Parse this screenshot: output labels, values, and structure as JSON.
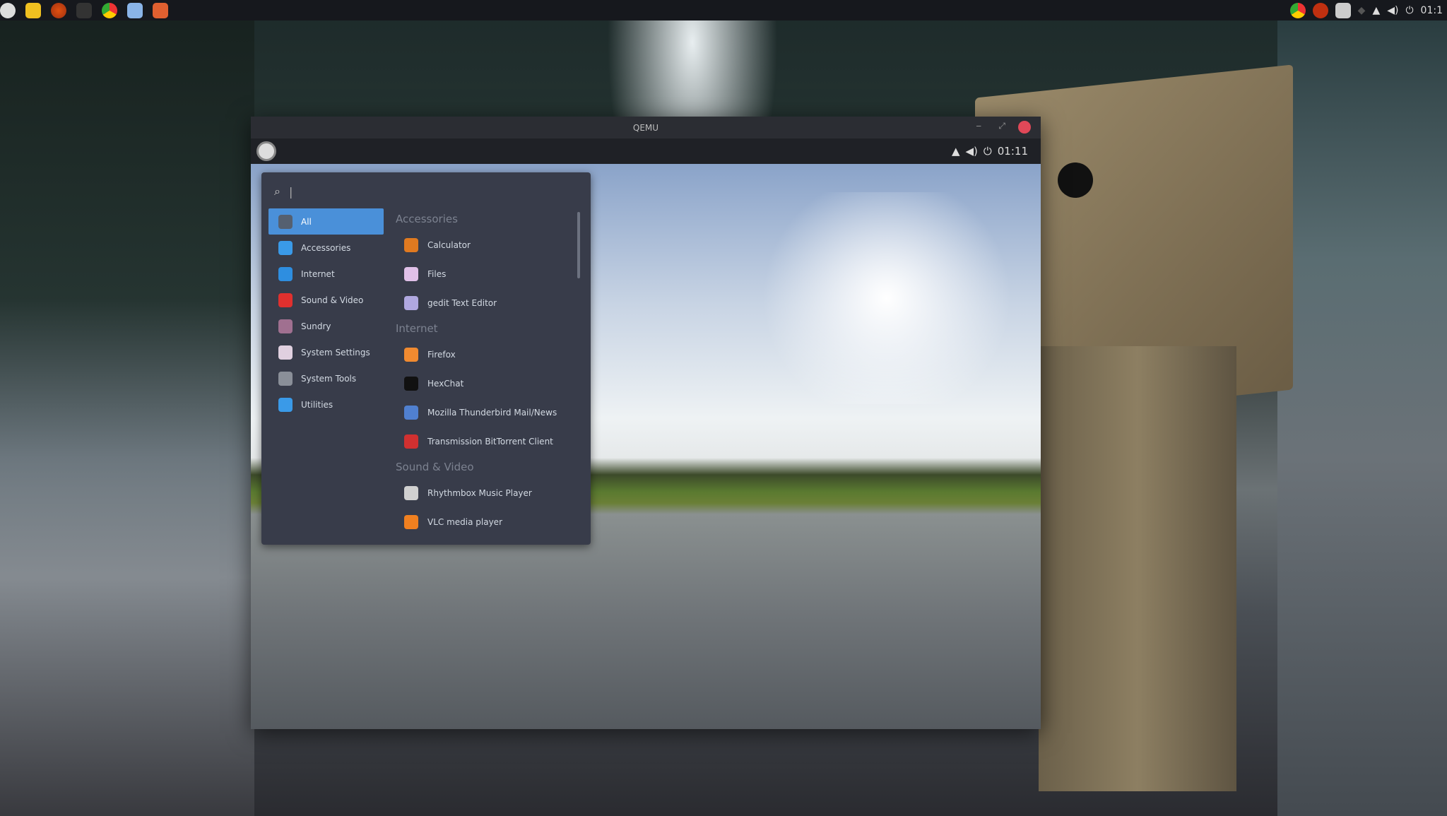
{
  "top_panel": {
    "launchers": [
      "files-icon",
      "cinnamon-icon",
      "terminal-icon",
      "chrome-icon",
      "browser-window-icon",
      "game-icon"
    ],
    "tray": {
      "icons": [
        "chrome-icon",
        "cinnamon-icon",
        "clipboard-icon",
        "network-icon",
        "bell-icon",
        "volume-icon",
        "power-icon"
      ],
      "clock": "01:1"
    }
  },
  "window": {
    "title": "QEMU",
    "minimize": "‒",
    "maximize": "⤢",
    "panel": {
      "clock": "01:11"
    },
    "menu": {
      "search_placeholder": "",
      "categories": [
        {
          "label": "All",
          "color": "#556070",
          "selected": true
        },
        {
          "label": "Accessories",
          "color": "#3a9ae8"
        },
        {
          "label": "Internet",
          "color": "#2e8ee0"
        },
        {
          "label": "Sound & Video",
          "color": "#e0302e"
        },
        {
          "label": "Sundry",
          "color": "#a07090"
        },
        {
          "label": "System Settings",
          "color": "#e0d0e0"
        },
        {
          "label": "System Tools",
          "color": "#8a8f98"
        },
        {
          "label": "Utilities",
          "color": "#3a9ae8"
        }
      ],
      "sections": [
        {
          "header": "Accessories",
          "apps": [
            {
              "label": "Calculator",
              "color": "#e07a20"
            },
            {
              "label": "Files",
              "color": "#e0c0e8"
            },
            {
              "label": "gedit Text Editor",
              "color": "#b0a8e0"
            }
          ]
        },
        {
          "header": "Internet",
          "apps": [
            {
              "label": "Firefox",
              "color": "#f08a30"
            },
            {
              "label": "HexChat",
              "color": "#111111"
            },
            {
              "label": "Mozilla Thunderbird Mail/News",
              "color": "#5080d0"
            },
            {
              "label": "Transmission BitTorrent Client",
              "color": "#d03030"
            }
          ]
        },
        {
          "header": "Sound & Video",
          "apps": [
            {
              "label": "Rhythmbox Music Player",
              "color": "#d0d0d0"
            },
            {
              "label": "VLC media player",
              "color": "#f08020"
            }
          ]
        }
      ]
    }
  }
}
